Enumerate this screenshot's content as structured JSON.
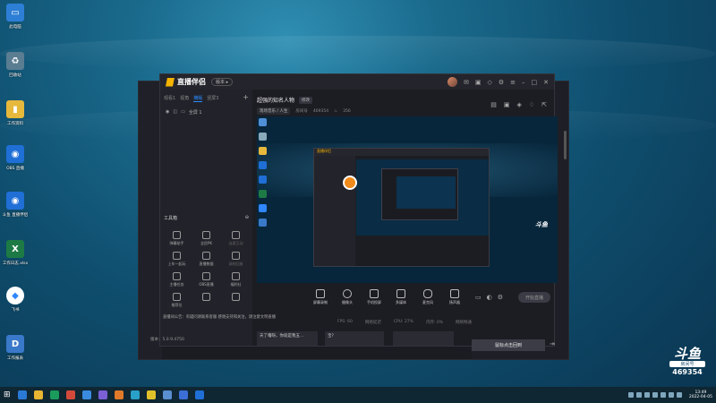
{
  "desktop": {
    "icons": [
      {
        "label": "此电脑",
        "color": "#2d7fd6",
        "glyph": "▭"
      },
      {
        "label": "回收站",
        "color": "#5a7d92",
        "glyph": "♻"
      },
      {
        "label": "工作资料",
        "color": "#e6b83c",
        "glyph": "▮"
      },
      {
        "label": "OBS 直播",
        "color": "#1f6fd6",
        "glyph": "◉"
      },
      {
        "label": "斗鱼 直播伴侣",
        "color": "#1f6fd6",
        "glyph": "◉"
      },
      {
        "label": "工作日志.xlsx",
        "color": "#1d7a45",
        "glyph": "X"
      },
      {
        "label": "飞书",
        "color": "#2f86ff",
        "glyph": "◆"
      },
      {
        "label": "工作报表",
        "color": "#3a79c9",
        "glyph": "D"
      }
    ]
  },
  "app": {
    "name": "直播伴侣",
    "version_pill": "版本 ▸",
    "tabs": [
      "观看1",
      "视角",
      "横版",
      "竖屏3"
    ],
    "active_tab": 2,
    "scene_item": "全屏 1",
    "tools_title": "工具箱",
    "tools": [
      {
        "label": "弹幕助手",
        "dim": false
      },
      {
        "label": "全民PK",
        "dim": false
      },
      {
        "label": "连麦互动",
        "dim": true
      },
      {
        "label": "上车一起玩",
        "dim": false
      },
      {
        "label": "直播数据",
        "dim": false
      },
      {
        "label": "录制回放",
        "dim": true
      },
      {
        "label": "主播任务",
        "dim": false
      },
      {
        "label": "OBS直播",
        "dim": false
      },
      {
        "label": "福利社",
        "dim": false
      },
      {
        "label": "推荐位",
        "dim": false
      },
      {
        "label": "",
        "dim": false
      },
      {
        "label": "",
        "dim": false
      }
    ],
    "stream": {
      "title": "超强的知名人物",
      "edit_label": "修改",
      "category": "现场音乐 / 人生",
      "room_label": "房间号",
      "room_number": "469354",
      "followers": "356"
    },
    "controls": [
      {
        "label": "屏幕录制"
      },
      {
        "label": "摄像头"
      },
      {
        "label": "手机投屏"
      },
      {
        "label": "多媒体"
      },
      {
        "label": "麦克风"
      },
      {
        "label": "扬声器"
      }
    ],
    "start_button": "开始直播",
    "status": {
      "fps": "FPS: 60",
      "net": "网络延迟",
      "cpu": "CPU: 27%",
      "mem": "内存: 0%",
      "network": "网络畅通"
    },
    "notice": "直播间公告：有疑问请联系客服  感谢支持和关注，请注意文明直播",
    "chat": [
      "天了噜呀，你就是我五...",
      "宝?"
    ],
    "version_text": "版本：5.0.9.4750",
    "back_button": "鼠标点击回到"
  },
  "overlay": {
    "brand": "斗鱼",
    "room_label": "房间号",
    "room_number": "469354"
  },
  "taskbar": {
    "time": "13:49",
    "date": "2022-04-05",
    "apps": [
      "#2b79d6",
      "#e8b633",
      "#1a9b5b",
      "#d44a3a",
      "#3a8be0",
      "#7a5fd6",
      "#e07a2a",
      "#28a0c8",
      "#e0c02a",
      "#5a8fd0",
      "#3b6fd6",
      "#1f6fd6"
    ]
  }
}
